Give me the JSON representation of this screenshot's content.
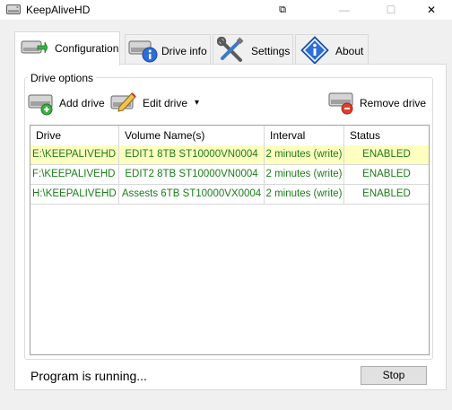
{
  "window": {
    "title": "KeepAliveHD",
    "controls": {
      "tool_glyph": "⧉",
      "minimize": "—",
      "maximize": "☐",
      "close": "✕"
    }
  },
  "tabs": [
    {
      "label": "Configuration",
      "icon": "hard-drive-arrow-icon",
      "active": true
    },
    {
      "label": "Drive info",
      "icon": "drive-info-icon",
      "active": false
    },
    {
      "label": "Settings",
      "icon": "wrench-screwdriver-icon",
      "active": false
    },
    {
      "label": "About",
      "icon": "info-diamond-icon",
      "active": false
    }
  ],
  "drive_options": {
    "group_title": "Drive options",
    "add_label": "Add drive",
    "edit_label": "Edit drive",
    "edit_arrow": "▾",
    "remove_label": "Remove drive"
  },
  "table": {
    "columns": [
      "Drive",
      "Volume Name(s)",
      "Interval",
      "Status"
    ],
    "rows": [
      {
        "drive": "E:\\KEEPALIVEHD",
        "volume": "EDIT1 8TB ST10000VN0004",
        "interval": "2 minutes (write)",
        "status": "ENABLED",
        "selected": true
      },
      {
        "drive": "F:\\KEEPALIVEHD",
        "volume": "EDIT2 8TB ST10000VN0004",
        "interval": "2 minutes (write)",
        "status": "ENABLED",
        "selected": false
      },
      {
        "drive": "H:\\KEEPALIVEHD",
        "volume": "Assests 6TB ST10000VX0004",
        "interval": "2 minutes (write)",
        "status": "ENABLED",
        "selected": false
      }
    ]
  },
  "status": {
    "text": "Program is running...",
    "stop_label": "Stop"
  },
  "colors": {
    "enabled_text": "#1a7d1a",
    "selected_row": "#ffffc0",
    "add_badge": "#3cb043",
    "remove_badge": "#e0402a"
  }
}
